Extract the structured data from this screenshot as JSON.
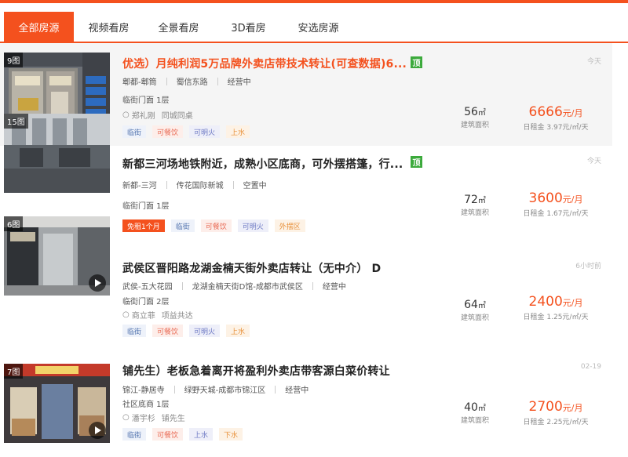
{
  "tabs": [
    "全部房源",
    "视频看房",
    "全景看房",
    "3D看房",
    "安选房源"
  ],
  "listings": [
    {
      "pic_count": "9图",
      "title": "优选）月纯利润5万品牌外卖店带技术转让(可查数据)6...",
      "top_badge": "顶",
      "district": "郫都-郫筒",
      "street": "蜀信东路",
      "status": "经营中",
      "floor": "临街门面 1层",
      "agent": "郑礼刚",
      "company": "同城同桌",
      "tags": [
        "临街",
        "可餐饮",
        "可明火",
        "上水"
      ],
      "area": "56",
      "area_unit": "㎡",
      "area_label": "建筑面积",
      "price": "6666",
      "price_unit": "元/月",
      "daily": "日租金 3.97元/㎡/天",
      "time": "今天"
    },
    {
      "pic_count": "15图",
      "title": "新都三河场地铁附近，成熟小区底商，可外摆搭篷，行...",
      "top_badge": "顶",
      "district": "新都-三河",
      "street": "传花国际新城",
      "status": "空置中",
      "floor": "临街门面 1层",
      "promo": "免租1个月",
      "tags": [
        "临街",
        "可餐饮",
        "可明火",
        "外摆区"
      ],
      "area": "72",
      "area_unit": "㎡",
      "area_label": "建筑面积",
      "price": "3600",
      "price_unit": "元/月",
      "daily": "日租金 1.67元/㎡/天",
      "time": "今天"
    },
    {
      "pic_count": "6图",
      "title": "武侯区晋阳路龙湖金楠天街外卖店转让（无中介） D",
      "district": "武侯-五大花园",
      "street": "龙湖金楠天街D馆-成都市武侯区",
      "status": "经营中",
      "floor": "临街门面 2层",
      "agent": "商立菲",
      "company": "项益共达",
      "tags": [
        "临街",
        "可餐饮",
        "可明火",
        "上水"
      ],
      "area": "64",
      "area_unit": "㎡",
      "area_label": "建筑面积",
      "price": "2400",
      "price_unit": "元/月",
      "daily": "日租金 1.25元/㎡/天",
      "time": "6小时前"
    },
    {
      "pic_count": "7图",
      "title": "铺先生）老板急着离开将盈利外卖店带客源白菜价转让",
      "district": "锦江-静居寺",
      "street": "绿野天城-成都市锦江区",
      "status": "经营中",
      "floor": "社区底商 1层",
      "agent": "潘宇杉",
      "company": "铺先生",
      "tags": [
        "临街",
        "可餐饮",
        "上水",
        "下水"
      ],
      "area": "40",
      "area_unit": "㎡",
      "area_label": "建筑面积",
      "price": "2700",
      "price_unit": "元/月",
      "daily": "日租金 2.25元/㎡/天",
      "time": "02-19"
    }
  ]
}
